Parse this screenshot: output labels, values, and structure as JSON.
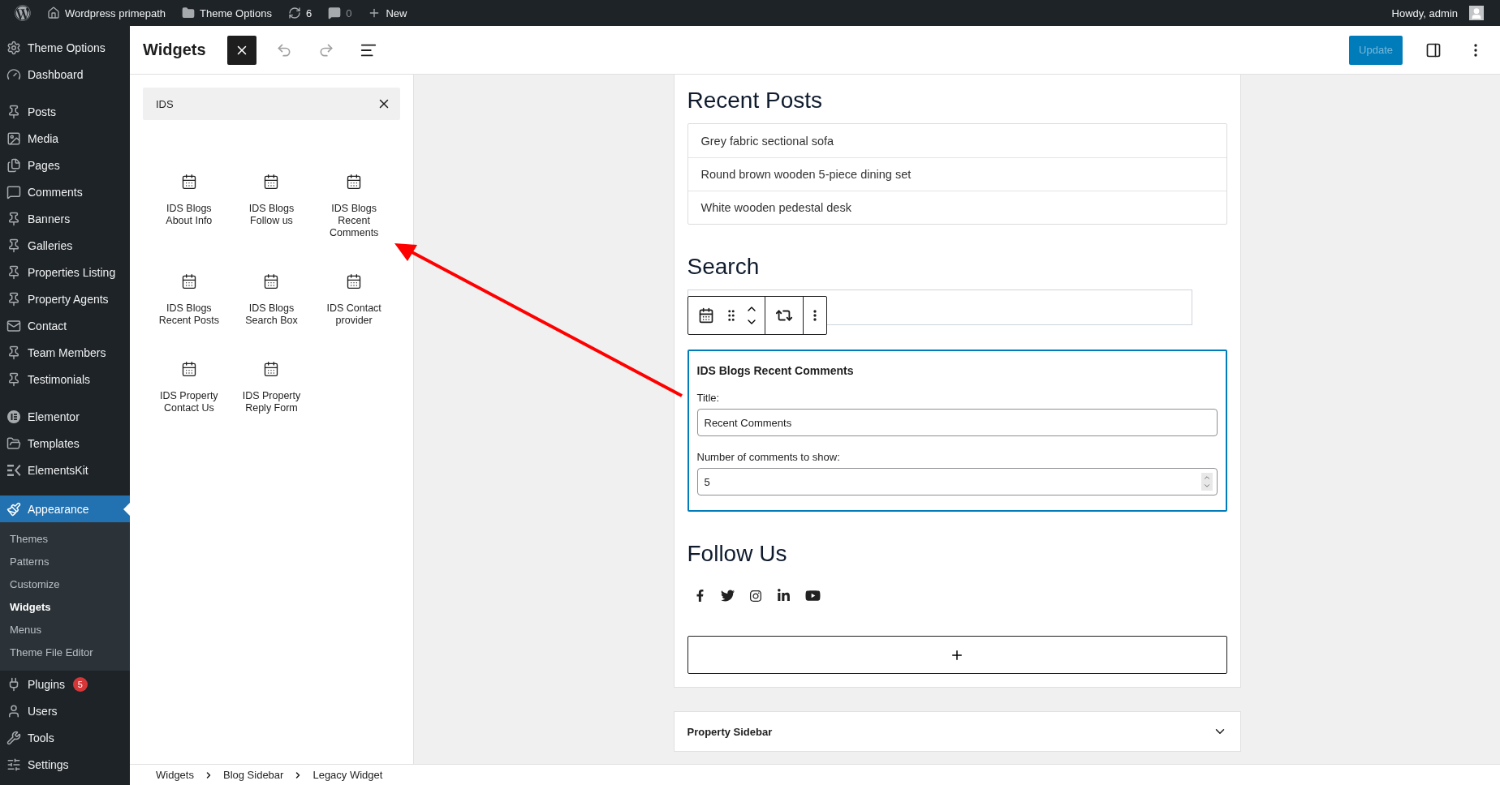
{
  "admin_bar": {
    "site": "Wordpress primepath",
    "items": [
      {
        "kind": "folder",
        "label": "Theme Options"
      },
      {
        "kind": "updates",
        "label": "6"
      },
      {
        "kind": "comments",
        "label": "0"
      },
      {
        "kind": "new",
        "label": "New"
      }
    ],
    "greeting": "Howdy, admin"
  },
  "sidebar": {
    "groups": [
      [
        {
          "kind": "gear",
          "label": "Theme Options",
          "selected": false
        },
        {
          "kind": "gauge",
          "label": "Dashboard",
          "selected": false
        }
      ],
      [
        {
          "kind": "pin",
          "label": "Posts",
          "selected": false
        },
        {
          "kind": "media",
          "label": "Media",
          "selected": false
        },
        {
          "kind": "pages",
          "label": "Pages",
          "selected": false
        },
        {
          "kind": "comment",
          "label": "Comments",
          "selected": false
        },
        {
          "kind": "pin",
          "label": "Banners",
          "selected": false
        },
        {
          "kind": "pin",
          "label": "Galleries",
          "selected": false
        },
        {
          "kind": "pin",
          "label": "Properties Listing",
          "selected": false
        },
        {
          "kind": "pin",
          "label": "Property Agents",
          "selected": false
        },
        {
          "kind": "mail",
          "label": "Contact",
          "selected": false
        },
        {
          "kind": "pin",
          "label": "Team Members",
          "selected": false
        },
        {
          "kind": "pin",
          "label": "Testimonials",
          "selected": false
        }
      ],
      [
        {
          "kind": "elementor",
          "label": "Elementor",
          "selected": false
        },
        {
          "kind": "folder",
          "label": "Templates",
          "selected": false
        },
        {
          "kind": "kit",
          "label": "ElementsKit",
          "selected": false
        }
      ],
      [
        {
          "kind": "brush",
          "label": "Appearance",
          "selected": true,
          "children": [
            {
              "label": "Themes",
              "selected": false
            },
            {
              "label": "Patterns",
              "selected": false
            },
            {
              "label": "Customize",
              "selected": false
            },
            {
              "label": "Widgets",
              "selected": true
            },
            {
              "label": "Menus",
              "selected": false
            },
            {
              "label": "Theme File Editor",
              "selected": false
            }
          ]
        },
        {
          "kind": "plug",
          "label": "Plugins",
          "selected": false,
          "badge": "5"
        },
        {
          "kind": "user",
          "label": "Users",
          "selected": false
        },
        {
          "kind": "wrench",
          "label": "Tools",
          "selected": false
        },
        {
          "kind": "settings",
          "label": "Settings",
          "selected": false
        }
      ]
    ]
  },
  "header": {
    "title": "Widgets",
    "update_button": "Update",
    "update_disabled": true
  },
  "inserter": {
    "search_value": "IDS",
    "blocks": [
      "IDS Blogs About Info",
      "IDS Blogs Follow us",
      "IDS Blogs Recent Comments",
      "IDS Blogs Recent Posts",
      "IDS Blogs Search Box",
      "IDS Contact provider",
      "IDS Property Contact Us",
      "IDS Property Reply Form"
    ]
  },
  "widget_area": {
    "recent_posts": {
      "title": "Recent Posts",
      "items": [
        "Grey fabric sectional sofa",
        "Round brown wooden 5-piece dining set",
        "White wooden pedestal desk"
      ]
    },
    "search": {
      "title": "Search"
    },
    "legacy_widget": {
      "title": "IDS Blogs Recent Comments",
      "fields": [
        {
          "kind": "text",
          "label": "Title:",
          "value": "Recent Comments"
        },
        {
          "kind": "number",
          "label": "Number of comments to show:",
          "value": "5"
        }
      ]
    },
    "follow_us": {
      "title": "Follow Us"
    }
  },
  "other_areas": [
    {
      "title": "Property Sidebar",
      "expanded": false
    }
  ],
  "breadcrumbs": [
    "Widgets",
    "Blog Sidebar",
    "Legacy Widget"
  ]
}
